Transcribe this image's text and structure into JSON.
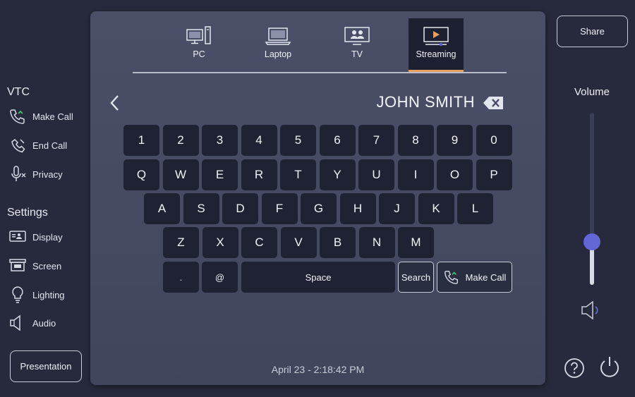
{
  "sidebar": {
    "vtc_title": "VTC",
    "vtc_items": [
      {
        "label": "Make Call",
        "icon": "phone-call-icon"
      },
      {
        "label": "End Call",
        "icon": "phone-hangup-icon"
      },
      {
        "label": "Privacy",
        "icon": "microphone-mute-icon"
      }
    ],
    "settings_title": "Settings",
    "settings_items": [
      {
        "label": "Display",
        "icon": "display-icon"
      },
      {
        "label": "Screen",
        "icon": "projector-screen-icon"
      },
      {
        "label": "Lighting",
        "icon": "lightbulb-icon"
      },
      {
        "label": "Audio",
        "icon": "speaker-icon"
      }
    ],
    "presentation_label": "Presentation"
  },
  "tabs": [
    {
      "label": "PC",
      "icon": "pc-icon",
      "active": false
    },
    {
      "label": "Laptop",
      "icon": "laptop-icon",
      "active": false
    },
    {
      "label": "TV",
      "icon": "tv-icon",
      "active": false
    },
    {
      "label": "Streaming",
      "icon": "streaming-icon",
      "active": true
    }
  ],
  "dialer": {
    "text": "JOHN SMITH"
  },
  "keyboard": {
    "row1": [
      "1",
      "2",
      "3",
      "4",
      "5",
      "6",
      "7",
      "8",
      "9",
      "0"
    ],
    "row2": [
      "Q",
      "W",
      "E",
      "R",
      "T",
      "Y",
      "U",
      "I",
      "O",
      "P"
    ],
    "row3": [
      "A",
      "S",
      "D",
      "F",
      "G",
      "H",
      "J",
      "K",
      "L"
    ],
    "row4": [
      "Z",
      "X",
      "C",
      "V",
      "B",
      "N",
      "M"
    ],
    "period": ".",
    "at": "@",
    "space": "Space",
    "search": "Search",
    "make_call": "Make Call"
  },
  "datetime": "April 23 - 2:18:42 PM",
  "right": {
    "share_label": "Share",
    "volume_label": "Volume",
    "volume_level": 0.25
  },
  "colors": {
    "accent": "#6366d6",
    "active_tab_underline": "#e8a060",
    "call_green": "#3ec46a"
  }
}
